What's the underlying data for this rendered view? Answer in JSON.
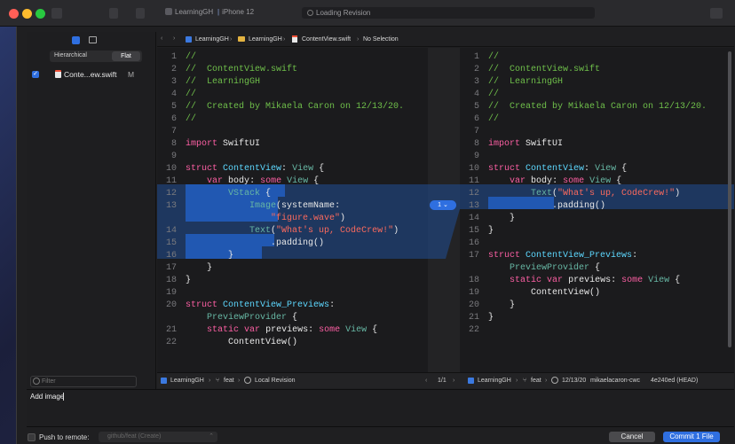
{
  "titlebar": {
    "scheme": "LearningGH",
    "device": "iPhone 12",
    "status": "Loading Revision",
    "colors": {
      "close": "#ff5f57",
      "minimize": "#febc2e",
      "zoom": "#28c840"
    }
  },
  "sidebar": {
    "segments": [
      "Hierarchical",
      "Flat"
    ],
    "selected_segment": "Flat",
    "file": {
      "name": "Conte...ew.swift",
      "status": "M",
      "checked": true
    },
    "filter_placeholder": "Filter"
  },
  "breadcrumb": {
    "items": [
      "LearningGH",
      "LearningGH",
      "ContentView.swift",
      "No Selection"
    ]
  },
  "left_pane": {
    "lines": [
      {
        "n": "1",
        "text": "//"
      },
      {
        "n": "2",
        "text": "//  ContentView.swift"
      },
      {
        "n": "3",
        "text": "//  LearningGH"
      },
      {
        "n": "4",
        "text": "//"
      },
      {
        "n": "5",
        "text": "//  Created by Mikaela Caron on 12/13/20."
      },
      {
        "n": "6",
        "text": "//"
      },
      {
        "n": "7",
        "text": ""
      },
      {
        "n": "8",
        "text": "import SwiftUI"
      },
      {
        "n": "9",
        "text": ""
      },
      {
        "n": "10",
        "text": "struct ContentView: View {"
      },
      {
        "n": "11",
        "text": "    var body: some View {"
      },
      {
        "n": "12",
        "text": "        VStack {"
      },
      {
        "n": "13",
        "text": "            Image(systemName:"
      },
      {
        "n": "",
        "text": "                \"figure.wave\")"
      },
      {
        "n": "14",
        "text": "            Text(\"What's up, CodeCrew!\")"
      },
      {
        "n": "15",
        "text": "                .padding()"
      },
      {
        "n": "16",
        "text": "        }"
      },
      {
        "n": "17",
        "text": "    }"
      },
      {
        "n": "18",
        "text": "}"
      },
      {
        "n": "19",
        "text": ""
      },
      {
        "n": "20",
        "text": "struct ContentView_Previews:"
      },
      {
        "n": "",
        "text": "    PreviewProvider {"
      },
      {
        "n": "21",
        "text": "    static var previews: some View {"
      },
      {
        "n": "22",
        "text": "        ContentView()"
      }
    ]
  },
  "right_pane": {
    "lines": [
      {
        "n": "1",
        "text": "//"
      },
      {
        "n": "2",
        "text": "//  ContentView.swift"
      },
      {
        "n": "3",
        "text": "//  LearningGH"
      },
      {
        "n": "4",
        "text": "//"
      },
      {
        "n": "5",
        "text": "//  Created by Mikaela Caron on 12/13/20."
      },
      {
        "n": "6",
        "text": "//"
      },
      {
        "n": "7",
        "text": ""
      },
      {
        "n": "8",
        "text": "import SwiftUI"
      },
      {
        "n": "9",
        "text": ""
      },
      {
        "n": "10",
        "text": "struct ContentView: View {"
      },
      {
        "n": "11",
        "text": "    var body: some View {"
      },
      {
        "n": "12",
        "text": "        Text(\"What's up, CodeCrew!\")"
      },
      {
        "n": "13",
        "text": "            .padding()"
      },
      {
        "n": "14",
        "text": "    }"
      },
      {
        "n": "15",
        "text": "}"
      },
      {
        "n": "16",
        "text": ""
      },
      {
        "n": "17",
        "text": "struct ContentView_Previews:"
      },
      {
        "n": "",
        "text": "    PreviewProvider {"
      },
      {
        "n": "18",
        "text": "    static var previews: some View {"
      },
      {
        "n": "19",
        "text": "        ContentView()"
      },
      {
        "n": "20",
        "text": "    }"
      },
      {
        "n": "21",
        "text": "}"
      },
      {
        "n": "22",
        "text": ""
      }
    ]
  },
  "change_marker": "1",
  "status_left": {
    "project": "LearningGH",
    "branch": "feat",
    "revision": "Local Revision"
  },
  "status_counter": "1/1",
  "status_right": {
    "project": "LearningGH",
    "branch": "feat",
    "date": "12/13/20",
    "author": "mikaelacaron-cwc",
    "commit": "4e240ed (HEAD)"
  },
  "commit_message": "Add image",
  "push": {
    "label": "Push to remote:",
    "remote": "github/feat (Create)"
  },
  "buttons": {
    "cancel": "Cancel",
    "commit": "Commit 1 File"
  },
  "accent_color": "#2f6fe0"
}
